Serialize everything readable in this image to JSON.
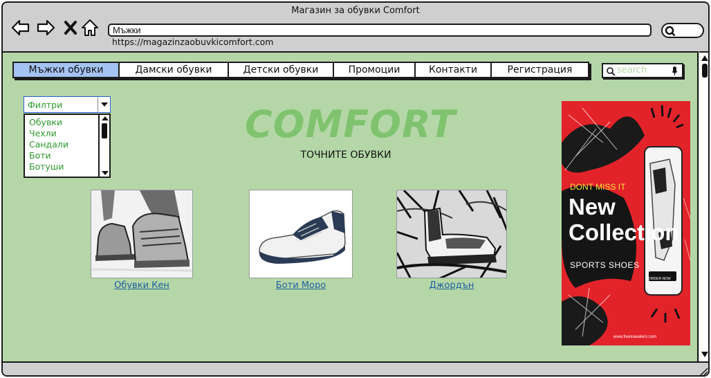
{
  "window": {
    "title": "Магазин за обувки Comfort",
    "address_value": "Мъжки",
    "url": "https://magazinzaobuvkicomfort.com"
  },
  "menu": {
    "items": [
      {
        "label": "Мъжки обувки",
        "active": true
      },
      {
        "label": "Дамски обувки",
        "active": false
      },
      {
        "label": "Детски обувки",
        "active": false
      },
      {
        "label": "Промоции",
        "active": false
      },
      {
        "label": "Контакти",
        "active": false
      },
      {
        "label": "Регистрация",
        "active": false
      }
    ]
  },
  "site_search": {
    "placeholder": "search"
  },
  "filters": {
    "selected": "Филтри",
    "options": [
      "Обувки",
      "Чехли",
      "Сандали",
      "Боти",
      "Ботуши"
    ]
  },
  "hero": {
    "brand": "COMFORT",
    "tagline": "ТОЧНИТЕ ОБУВКИ"
  },
  "products": [
    {
      "name": "Обувки Кен"
    },
    {
      "name": "Боти Моро"
    },
    {
      "name": "Джордън"
    }
  ],
  "ad": {
    "line1": "DONT MISS IT",
    "line2": "New",
    "line3": "Collection",
    "line4": "SPORTS SHOES",
    "cta": "ORDER NOW",
    "site": "www.freesneakers.com"
  },
  "colors": {
    "content_bg": "#b5d7a8",
    "active_menu": "#a4c3f2",
    "brand_green": "#7fc36e",
    "filter_text": "#2a9a2a",
    "link": "#1f5fa0",
    "ad_red": "#e3232a"
  }
}
